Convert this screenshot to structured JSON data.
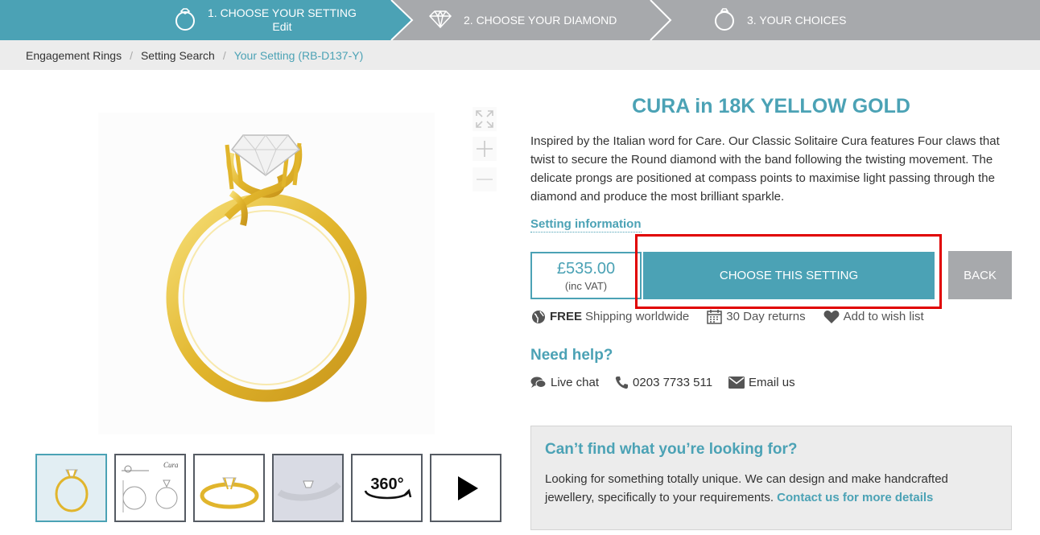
{
  "steps": {
    "step1_label": "1.  CHOOSE YOUR SETTING",
    "step1_sub": "Edit",
    "step2_label": "2. CHOOSE YOUR DIAMOND",
    "step3_label": "3. YOUR CHOICES",
    "active_color": "#4ba2b5",
    "inactive_color": "#a7a9ac"
  },
  "breadcrumb": {
    "items": [
      "Engagement Rings",
      "Setting Search"
    ],
    "current": "Your Setting (RB-D137-Y)",
    "separator": "/"
  },
  "gallery": {
    "zoom_icons": [
      "expand-icon",
      "zoom-in-icon",
      "zoom-out-icon"
    ],
    "thumbs": [
      {
        "name": "ring-side-view",
        "active": true
      },
      {
        "name": "ring-technical-drawing",
        "caption": "Cura"
      },
      {
        "name": "ring-angle-view"
      },
      {
        "name": "ring-worn-view"
      },
      {
        "name": "360-view",
        "label": "360°"
      },
      {
        "name": "video-play"
      }
    ]
  },
  "product": {
    "title": "CURA in 18K YELLOW GOLD",
    "description": "Inspired by the Italian word for Care. Our Classic Solitaire Cura features Four claws that twist to secure the Round diamond with the band following the twisting movement. The delicate prongs are positioned at compass points to maximise light passing through the diamond and produce the most brilliant sparkle.",
    "setting_info_link": "Setting information",
    "price": "£535.00",
    "vat": "(inc VAT)",
    "choose_button": "CHOOSE THIS SETTING",
    "back_button": "BACK"
  },
  "perks": {
    "shipping_bold": "FREE",
    "shipping_text": "Shipping worldwide",
    "returns": "30 Day returns",
    "wishlist": "Add to wish list"
  },
  "help": {
    "title": "Need help?",
    "live_chat": "Live chat",
    "phone": "0203 7733 511",
    "email": "Email us"
  },
  "cant_find": {
    "title": "Can’t find what you’re looking for?",
    "text": "Looking for something totally unique. We can design and make handcrafted jewellery, specifically to your requirements.",
    "link": "Contact us for more details"
  },
  "colors": {
    "accent": "#4ba2b5",
    "gold": "#e9c13a",
    "highlight": "#e00000"
  }
}
